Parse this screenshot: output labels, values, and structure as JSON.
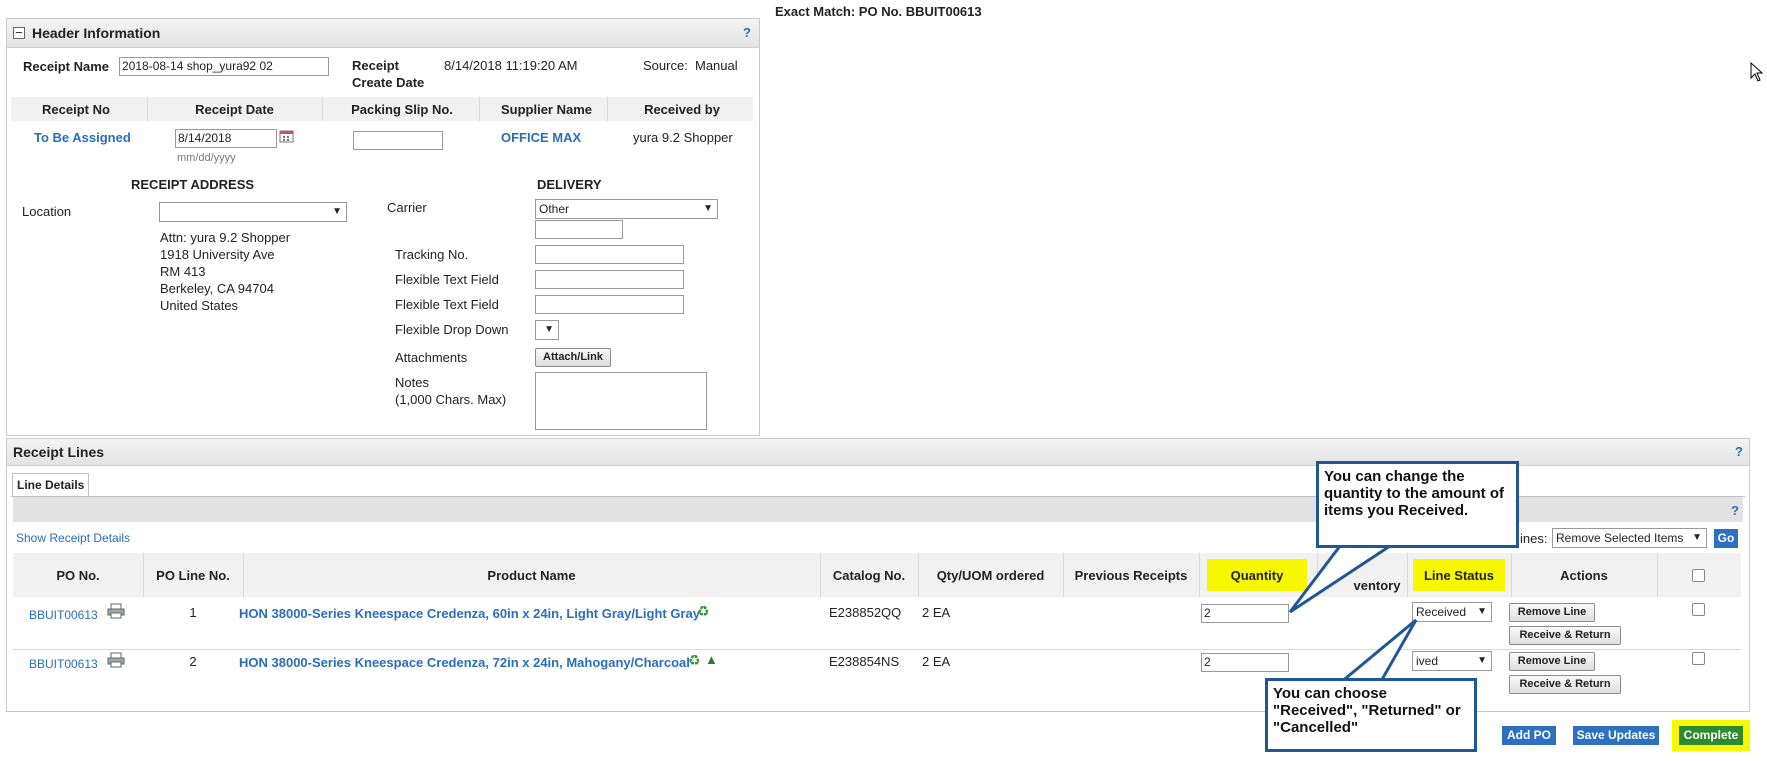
{
  "exact_match": "Exact Match: PO No. BBUIT00613",
  "header": {
    "title": "Header Information",
    "help": "?",
    "receipt_name_label": "Receipt Name",
    "receipt_name_value": "2018-08-14 shop_yura92 02",
    "receipt_create_label_1": "Receipt",
    "receipt_create_label_2": "Create Date",
    "receipt_create_value": "8/14/2018 11:19:20 AM",
    "source_label": "Source:",
    "source_value": "Manual",
    "columns": [
      "Receipt No",
      "Receipt Date",
      "Packing Slip No.",
      "Supplier Name",
      "Received by"
    ],
    "receipt_no": "To Be Assigned",
    "receipt_date": "8/14/2018",
    "date_hint": "mm/dd/yyyy",
    "packing_slip": "",
    "supplier": "OFFICE MAX",
    "received_by": "yura 9.2 Shopper",
    "receipt_address_title": "RECEIPT ADDRESS",
    "location_label": "Location",
    "location_value": "",
    "address_lines": [
      "Attn: yura 9.2 Shopper",
      "1918 University Ave",
      "RM 413",
      "Berkeley, CA 94704",
      "United States"
    ],
    "delivery_title": "DELIVERY",
    "carrier_label": "Carrier",
    "carrier_value": "Other",
    "tracking_label": "Tracking No.",
    "flex1_label": "Flexible Text Field",
    "flex2_label": "Flexible Text Field",
    "flexdrop_label": "Flexible Drop Down",
    "attachments_label": "Attachments",
    "attach_button": "Attach/Link",
    "notes_label_1": "Notes",
    "notes_label_2": "(1,000 Chars. Max)"
  },
  "lines": {
    "title": "Receipt Lines",
    "help": "?",
    "tab": "Line Details",
    "show_details": "Show Receipt Details",
    "for_lines_label": "ines:",
    "for_lines_select": "Remove Selected Items",
    "go": "Go",
    "columns": [
      "PO No.",
      "PO Line No.",
      "Product Name",
      "Catalog No.",
      "Qty/UOM ordered",
      "Previous Receipts",
      "Quantity",
      "ventory",
      "Line Status",
      "Actions"
    ],
    "rows": [
      {
        "po": "BBUIT00613",
        "line": "1",
        "product": "HON 38000-Series Kneespace Credenza, 60in x 24in, Light Gray/Light Gray",
        "catalog": "E238852QQ",
        "qty_ordered": "2 EA",
        "quantity": "2",
        "status": "Received"
      },
      {
        "po": "BBUIT00613",
        "line": "2",
        "product": "HON 38000-Series Kneespace Credenza, 72in x 24in, Mahogany/Charcoal",
        "catalog": "E238854NS",
        "qty_ordered": "2 EA",
        "quantity": "2",
        "status": "ived"
      }
    ],
    "remove_line": "Remove Line",
    "receive_return": "Receive & Return"
  },
  "footer": {
    "add_po": "Add PO",
    "save_updates": "Save Updates",
    "complete": "Complete"
  },
  "callouts": {
    "quantity": "You can change the quantity to the amount of items you Received.",
    "status": "You can choose \"Received\", \"Returned\" or \"Cancelled\""
  },
  "colors": {
    "link": "#2a6ebb",
    "highlight": "#f7f700",
    "callout_border": "#1f5796",
    "button_blue": "#2d6fc0"
  }
}
